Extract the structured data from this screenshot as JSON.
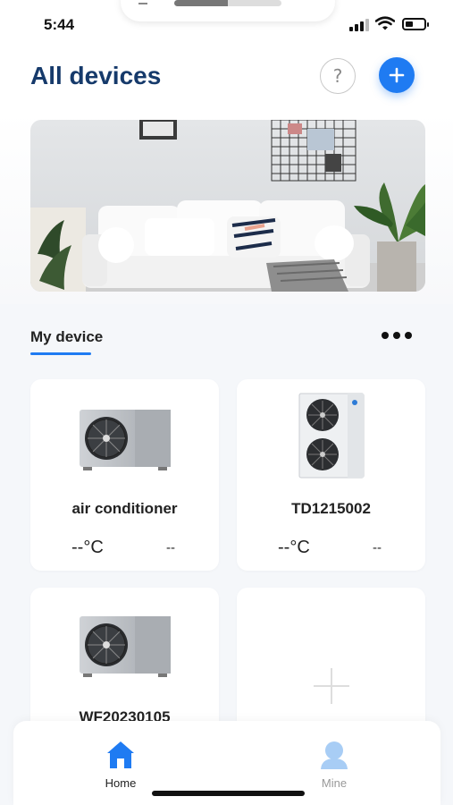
{
  "status_bar": {
    "time": "5:44"
  },
  "header": {
    "title": "All devices",
    "help_label": "?"
  },
  "section": {
    "title": "My device"
  },
  "devices": [
    {
      "name": "air conditioner",
      "temperature": "--°C",
      "mode": "--",
      "image": "heat-pump-unit-horizontal"
    },
    {
      "name": "TD1215002",
      "temperature": "--°C",
      "mode": "--",
      "image": "heat-pump-unit-vertical-twin-fan"
    },
    {
      "name": "WF20230105",
      "image": "heat-pump-unit-horizontal"
    }
  ],
  "nav": [
    {
      "label": "Home",
      "icon": "home-icon",
      "active": true
    },
    {
      "label": "Mine",
      "icon": "user-icon",
      "active": false
    }
  ],
  "colors": {
    "accent": "#1f7bf2",
    "title": "#163a6b",
    "background": "#f5f7fa"
  }
}
